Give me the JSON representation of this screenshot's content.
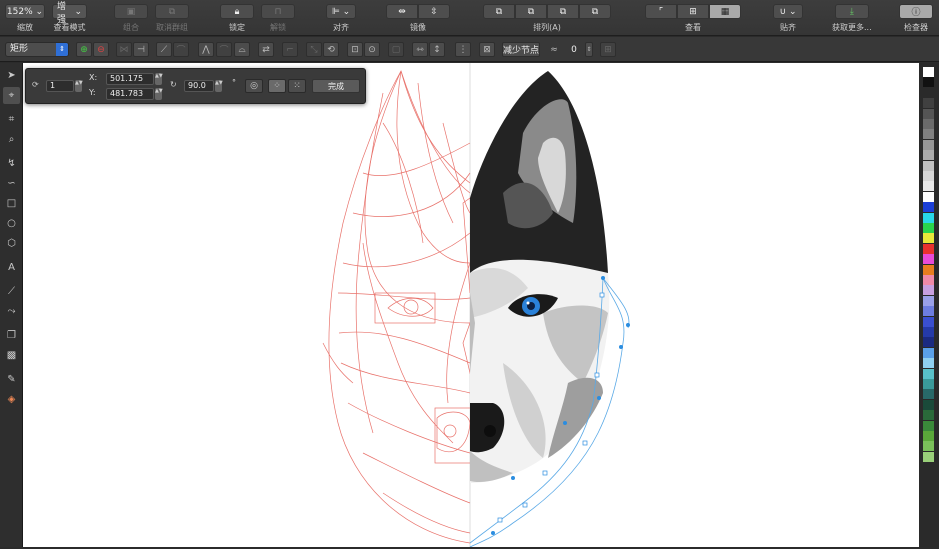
{
  "toolbar": {
    "zoom": {
      "value": "152%",
      "label": "缩放"
    },
    "view_mode": {
      "value": "增强",
      "label": "查看模式"
    },
    "group": {
      "label": "组合"
    },
    "ungroup": {
      "label": "取消群组"
    },
    "lock": {
      "label": "锁定"
    },
    "unlock": {
      "label": "解锁"
    },
    "align": {
      "label": "对齐"
    },
    "mirror": {
      "label": "镜像"
    },
    "arrange": {
      "label": "排列(A)"
    },
    "view": {
      "label": "查看"
    },
    "snap": {
      "label": "贴齐"
    },
    "get_more": {
      "label": "获取更多..."
    },
    "inspector": {
      "label": "检查器"
    }
  },
  "propbar": {
    "shape_type": "矩形",
    "reduce_nodes": "减少节点",
    "smoothness": "0"
  },
  "transform_bar": {
    "count": "1",
    "x_label": "X:",
    "x_value": "501.175",
    "y_label": "Y:",
    "y_value": "481.783",
    "angle": "90.0",
    "done": "完成"
  },
  "palette_colors": [
    "#ffffff",
    "#111111",
    "#2a2a2a",
    "#404040",
    "#555555",
    "#6b6b6b",
    "#808080",
    "#969696",
    "#ababab",
    "#c1c1c1",
    "#d6d6d6",
    "#e9e9e9",
    "#ffffff",
    "#1c3fd6",
    "#28d7e8",
    "#2ad44d",
    "#e8e83a",
    "#e8322e",
    "#e84bd7",
    "#e87d1e",
    "#f08aa8",
    "#c8a0e0",
    "#9aa0e8",
    "#6d7de0",
    "#3a4fd0",
    "#253aa8",
    "#1b2a80",
    "#5aa0e8",
    "#8fd0f0",
    "#58c0c8",
    "#3a9a9a",
    "#286868",
    "#1a4a3a",
    "#2a6a3a",
    "#3a8a3a",
    "#5aa83a",
    "#7ac05a",
    "#9ad07a"
  ]
}
